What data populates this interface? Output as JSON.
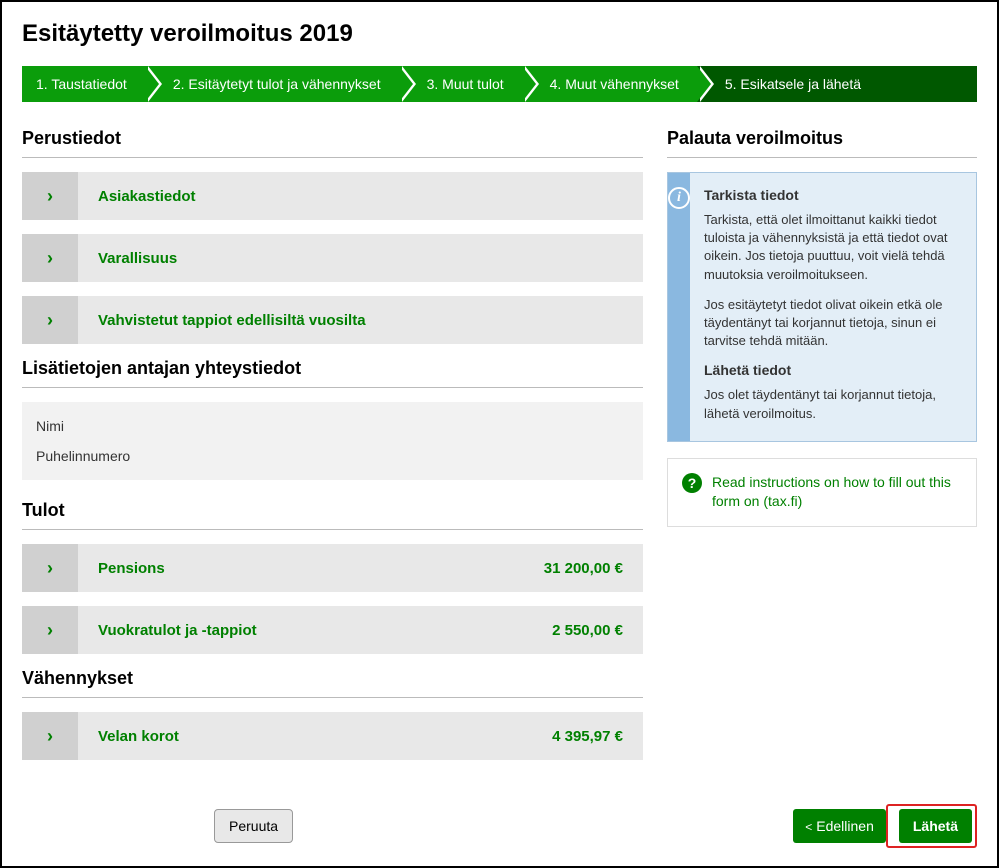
{
  "title": "Esitäytetty veroilmoitus 2019",
  "steps": [
    {
      "label": "1. Taustatiedot"
    },
    {
      "label": "2. Esitäytetyt tulot ja vähennykset"
    },
    {
      "label": "3. Muut tulot"
    },
    {
      "label": "4. Muut vähennykset"
    },
    {
      "label": "5. Esikatsele ja lähetä"
    }
  ],
  "sections": {
    "perustiedot": {
      "heading": "Perustiedot",
      "items": [
        {
          "label": "Asiakastiedot"
        },
        {
          "label": "Varallisuus"
        },
        {
          "label": "Vahvistetut tappiot edellisiltä vuosilta"
        }
      ]
    },
    "contact": {
      "heading": "Lisätietojen antajan yhteystiedot",
      "name_label": "Nimi",
      "phone_label": "Puhelinnumero"
    },
    "tulot": {
      "heading": "Tulot",
      "items": [
        {
          "label": "Pensions",
          "value": "31 200,00 €"
        },
        {
          "label": "Vuokratulot ja -tappiot",
          "value": "2 550,00 €"
        }
      ]
    },
    "vahennykset": {
      "heading": "Vähennykset",
      "items": [
        {
          "label": "Velan korot",
          "value": "4 395,97 €"
        }
      ]
    }
  },
  "sidebar": {
    "heading": "Palauta veroilmoitus",
    "info": {
      "h1": "Tarkista tiedot",
      "p1": "Tarkista, että olet ilmoittanut kaikki tiedot tuloista ja vähennyksistä ja että tiedot ovat oikein. Jos tietoja puuttuu, voit vielä tehdä muutoksia veroilmoitukseen.",
      "p2": "Jos esitäytetyt tiedot olivat oikein etkä ole täydentänyt tai korjannut tietoja, sinun ei tarvitse tehdä mitään.",
      "h2": "Lähetä tiedot",
      "p3": "Jos olet täydentänyt tai korjannut tietoja, lähetä veroilmoitus."
    },
    "help_link": "Read instructions on how to fill out this form on (tax.fi)"
  },
  "buttons": {
    "cancel": "Peruuta",
    "prev": "Edellinen",
    "send": "Lähetä"
  }
}
